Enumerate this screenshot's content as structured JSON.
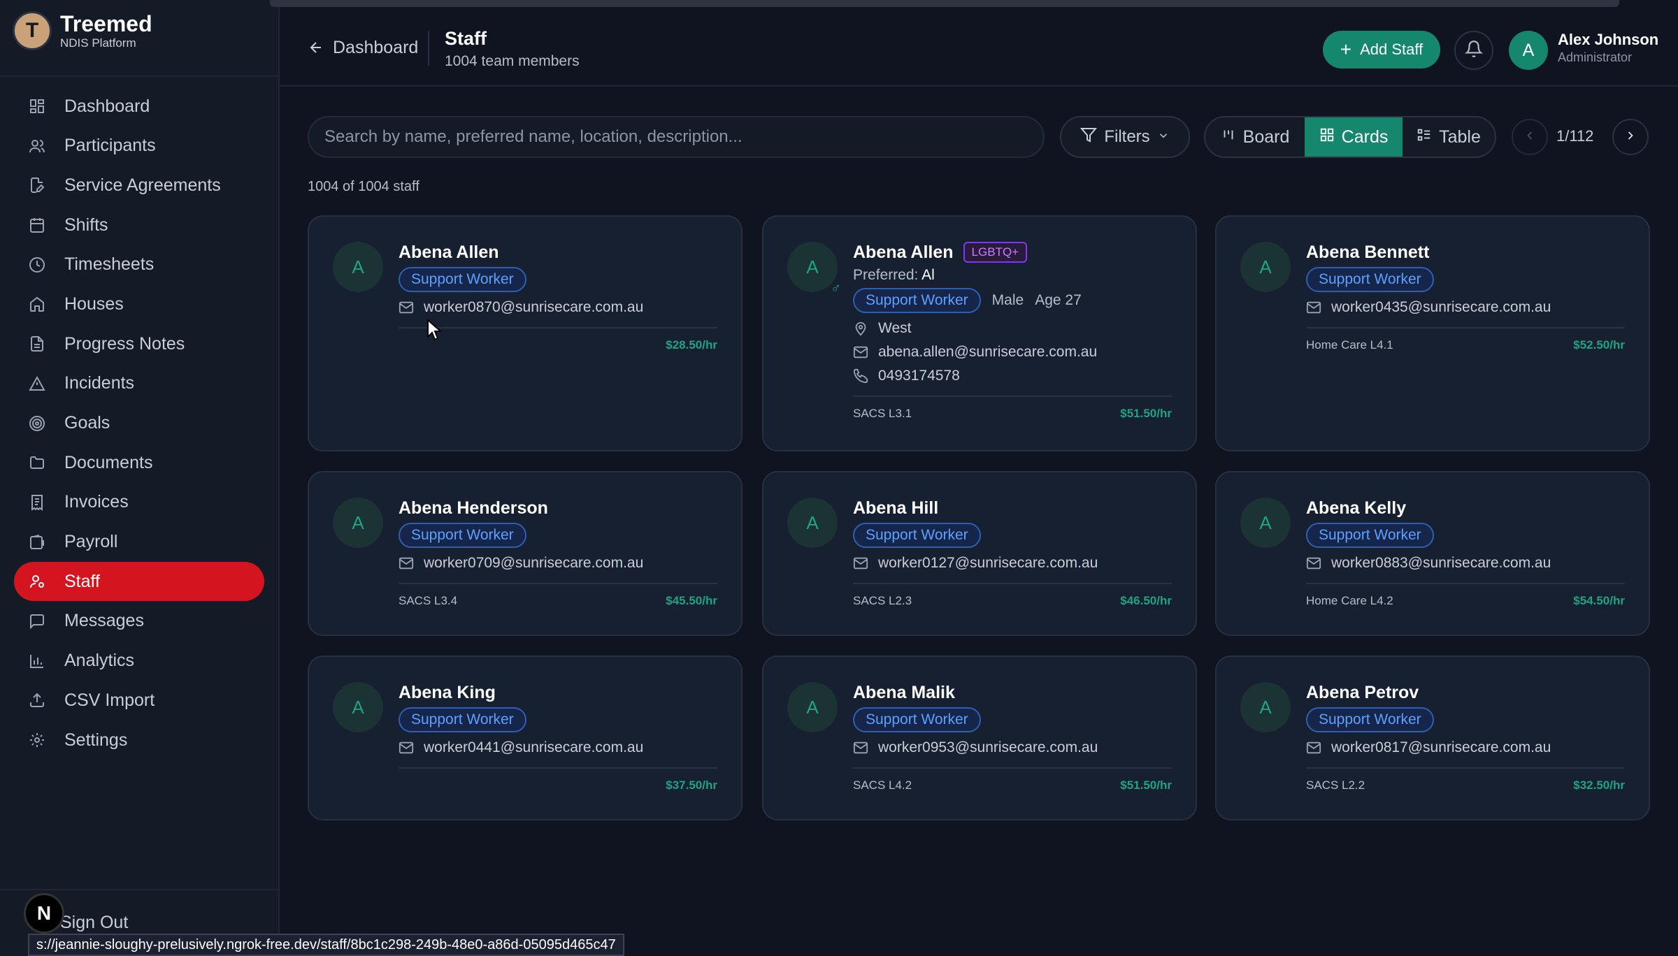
{
  "brand": {
    "logo_letter": "T",
    "name": "Treemed",
    "subtitle": "NDIS Platform"
  },
  "nav": [
    {
      "label": "Dashboard",
      "icon": "grid-icon",
      "active": false
    },
    {
      "label": "Participants",
      "icon": "users-icon",
      "active": false
    },
    {
      "label": "Service Agreements",
      "icon": "file-edit-icon",
      "active": false
    },
    {
      "label": "Shifts",
      "icon": "calendar-icon",
      "active": false
    },
    {
      "label": "Timesheets",
      "icon": "clock-icon",
      "active": false
    },
    {
      "label": "Houses",
      "icon": "home-icon",
      "active": false
    },
    {
      "label": "Progress Notes",
      "icon": "file-text-icon",
      "active": false
    },
    {
      "label": "Incidents",
      "icon": "alert-triangle-icon",
      "active": false
    },
    {
      "label": "Goals",
      "icon": "target-icon",
      "active": false
    },
    {
      "label": "Documents",
      "icon": "folder-icon",
      "active": false
    },
    {
      "label": "Invoices",
      "icon": "receipt-icon",
      "active": false
    },
    {
      "label": "Payroll",
      "icon": "wallet-icon",
      "active": false
    },
    {
      "label": "Staff",
      "icon": "user-cog-icon",
      "active": true
    },
    {
      "label": "Messages",
      "icon": "message-icon",
      "active": false
    },
    {
      "label": "Analytics",
      "icon": "bar-chart-icon",
      "active": false
    },
    {
      "label": "CSV Import",
      "icon": "upload-icon",
      "active": false
    },
    {
      "label": "Settings",
      "icon": "gear-icon",
      "active": false
    }
  ],
  "signout_label": "Sign Out",
  "n_badge": "N",
  "status_url": "s://jeannie-sloughy-prelusively.ngrok-free.dev/staff/8bc1c298-249b-48e0-a86d-05095d465c47",
  "header": {
    "back_label": "Dashboard",
    "title": "Staff",
    "subtitle": "1004 team members",
    "add_label": "Add Staff",
    "user": {
      "initial": "A",
      "name": "Alex Johnson",
      "role": "Administrator"
    }
  },
  "toolbar": {
    "search_placeholder": "Search by name, preferred name, location, description...",
    "filters_label": "Filters",
    "views": [
      "Board",
      "Cards",
      "Table"
    ],
    "active_view": "Cards",
    "page": "1/112"
  },
  "count_text": "1004 of 1004 staff",
  "colors": {
    "accent": "#14876c",
    "active_nav": "#d4141e",
    "role_badge": "#5ea0ff",
    "rate": "#1ea383"
  },
  "cards": [
    {
      "initial": "A",
      "name": "Abena Allen",
      "role": "Support Worker",
      "email": "worker0870@sunrisecare.com.au",
      "level": "",
      "rate": "$28.50/hr"
    },
    {
      "initial": "A",
      "name": "Abena Allen",
      "lgbt": "LGBTQ+",
      "pref_label": "Preferred:",
      "pref_value": "Al",
      "role": "Support Worker",
      "gender": "Male",
      "age": "Age 27",
      "location": "West",
      "email": "abena.allen@sunrisecare.com.au",
      "phone": "0493174578",
      "level": "SACS L3.1",
      "rate": "$51.50/hr"
    },
    {
      "initial": "A",
      "name": "Abena Bennett",
      "role": "Support Worker",
      "email": "worker0435@sunrisecare.com.au",
      "level": "Home Care L4.1",
      "rate": "$52.50/hr"
    },
    {
      "initial": "A",
      "name": "Abena Henderson",
      "role": "Support Worker",
      "email": "worker0709@sunrisecare.com.au",
      "level": "SACS L3.4",
      "rate": "$45.50/hr"
    },
    {
      "initial": "A",
      "name": "Abena Hill",
      "role": "Support Worker",
      "email": "worker0127@sunrisecare.com.au",
      "level": "SACS L2.3",
      "rate": "$46.50/hr"
    },
    {
      "initial": "A",
      "name": "Abena Kelly",
      "role": "Support Worker",
      "email": "worker0883@sunrisecare.com.au",
      "level": "Home Care L4.2",
      "rate": "$54.50/hr"
    },
    {
      "initial": "A",
      "name": "Abena King",
      "role": "Support Worker",
      "email": "worker0441@sunrisecare.com.au",
      "level": "",
      "rate": "$37.50/hr"
    },
    {
      "initial": "A",
      "name": "Abena Malik",
      "role": "Support Worker",
      "email": "worker0953@sunrisecare.com.au",
      "level": "SACS L4.2",
      "rate": "$51.50/hr"
    },
    {
      "initial": "A",
      "name": "Abena Petrov",
      "role": "Support Worker",
      "email": "worker0817@sunrisecare.com.au",
      "level": "SACS L2.2",
      "rate": "$32.50/hr"
    }
  ]
}
